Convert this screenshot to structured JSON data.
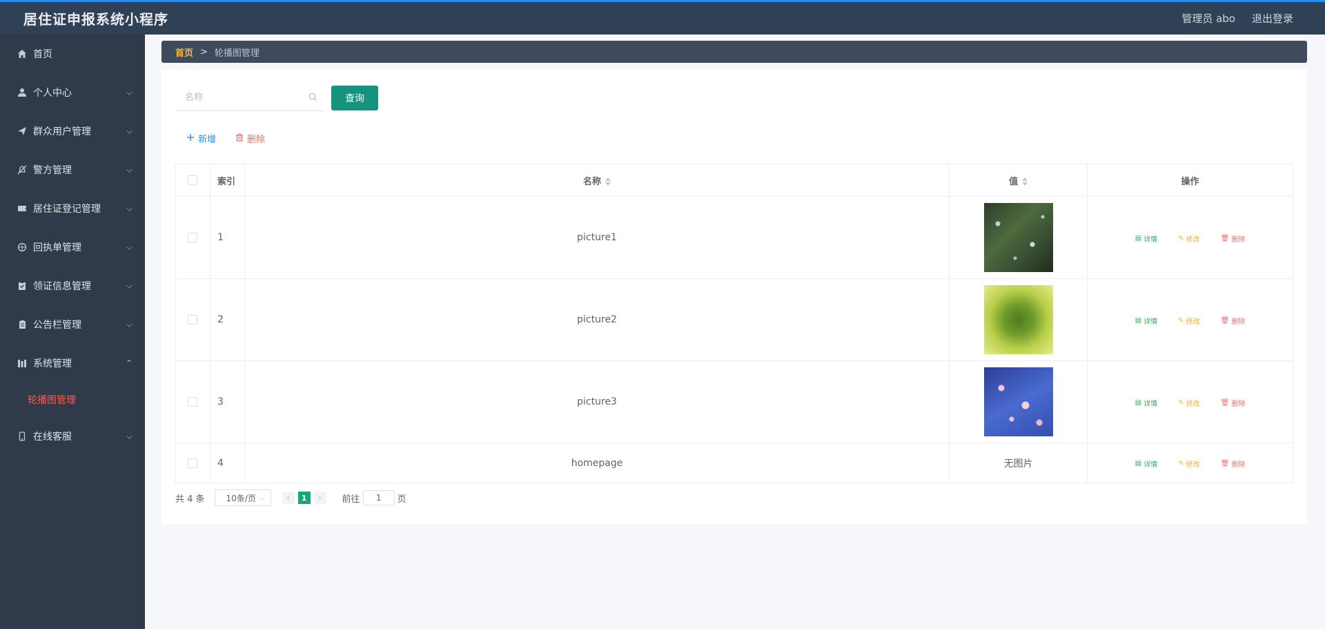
{
  "header": {
    "title": "居住证申报系统小程序",
    "user": "管理员 abo",
    "logout": "退出登录"
  },
  "sidebar": {
    "items": [
      {
        "label": "首页",
        "icon": "home-icon"
      },
      {
        "label": "个人中心",
        "icon": "user-icon"
      },
      {
        "label": "群众用户管理",
        "icon": "send-icon"
      },
      {
        "label": "警方管理",
        "icon": "no-bell-icon"
      },
      {
        "label": "居住证登记管理",
        "icon": "ticket-icon"
      },
      {
        "label": "回执单管理",
        "icon": "basketball-icon"
      },
      {
        "label": "领证信息管理",
        "icon": "clipboard-icon"
      },
      {
        "label": "公告栏管理",
        "icon": "notebook-icon"
      },
      {
        "label": "系统管理",
        "icon": "stats-icon"
      },
      {
        "label": "在线客服",
        "icon": "phone-icon"
      }
    ],
    "subitem": "轮播图管理"
  },
  "breadcrumb": {
    "home": "首页",
    "separator": ">",
    "current": "轮播图管理"
  },
  "search": {
    "placeholder": "名称",
    "button": "查询"
  },
  "actions": {
    "add": "新增",
    "delete": "删除"
  },
  "table": {
    "headers": {
      "index": "索引",
      "name": "名称",
      "value": "值",
      "ops": "操作"
    },
    "rows": [
      {
        "index": "1",
        "name": "picture1",
        "image": "thumb1"
      },
      {
        "index": "2",
        "name": "picture2",
        "image": "thumb2"
      },
      {
        "index": "3",
        "name": "picture3",
        "image": "thumb3"
      },
      {
        "index": "4",
        "name": "homepage",
        "value": "无图片"
      }
    ],
    "ops": {
      "detail": "详情",
      "edit": "修改",
      "delete": "删除"
    }
  },
  "pager": {
    "total": "共 4 条",
    "page_size": "10条/页",
    "current_page": "1",
    "goto_prefix": "前往",
    "goto_value": "1",
    "goto_suffix": "页"
  }
}
